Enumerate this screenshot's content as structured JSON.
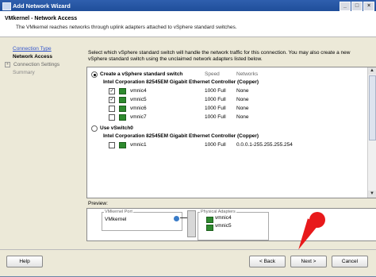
{
  "window": {
    "title": "Add Network Wizard"
  },
  "header": {
    "title": "VMkernel - Network Access",
    "description": "The VMkernel reaches networks through uplink adapters attached to vSphere standard switches."
  },
  "nav": {
    "link_connection_type": "Connection Type",
    "current": "Network Access",
    "connection_settings": "Connection Settings",
    "summary": "Summary",
    "expander": "+"
  },
  "main": {
    "intro": "Select which vSphere standard switch will handle the network traffic for this connection. You may also create a new vSphere standard switch using the unclaimed network adapters listed below.",
    "option_create": "Create a vSphere standard switch",
    "col_speed": "Speed",
    "col_networks": "Networks",
    "controller1": "Intel Corporation 82545EM Gigabit Ethernet Controller (Copper)",
    "nics1": [
      {
        "name": "vmnic4",
        "speed": "1000 Full",
        "networks": "None",
        "checked": true
      },
      {
        "name": "vmnic5",
        "speed": "1000 Full",
        "networks": "None",
        "checked": true
      },
      {
        "name": "vmnic6",
        "speed": "1000 Full",
        "networks": "None",
        "checked": false
      },
      {
        "name": "vmnic7",
        "speed": "1000 Full",
        "networks": "None",
        "checked": false
      }
    ],
    "option_use": "Use vSwitch0",
    "controller2": "Intel Corporation 82545EM Gigabit Ethernet Controller (Copper)",
    "nics2": [
      {
        "name": "vmnic1",
        "speed": "1000 Full",
        "networks": "0.0.0.1-255.255.255.254",
        "checked": false
      }
    ],
    "check_mark": "✓"
  },
  "preview": {
    "label": "Preview:",
    "port_caption": "VMkernel Port",
    "port_name": "VMkernel",
    "adapters_caption": "Physical Adapters",
    "adapters": [
      "vmnic4",
      "vmnic5"
    ]
  },
  "footer": {
    "help": "Help",
    "back": "< Back",
    "next": "Next >",
    "cancel": "Cancel"
  },
  "colors": {
    "titlebar": "#1f4e9a",
    "pin": "#e8191b",
    "nic_icon": "#2e8a2e"
  }
}
